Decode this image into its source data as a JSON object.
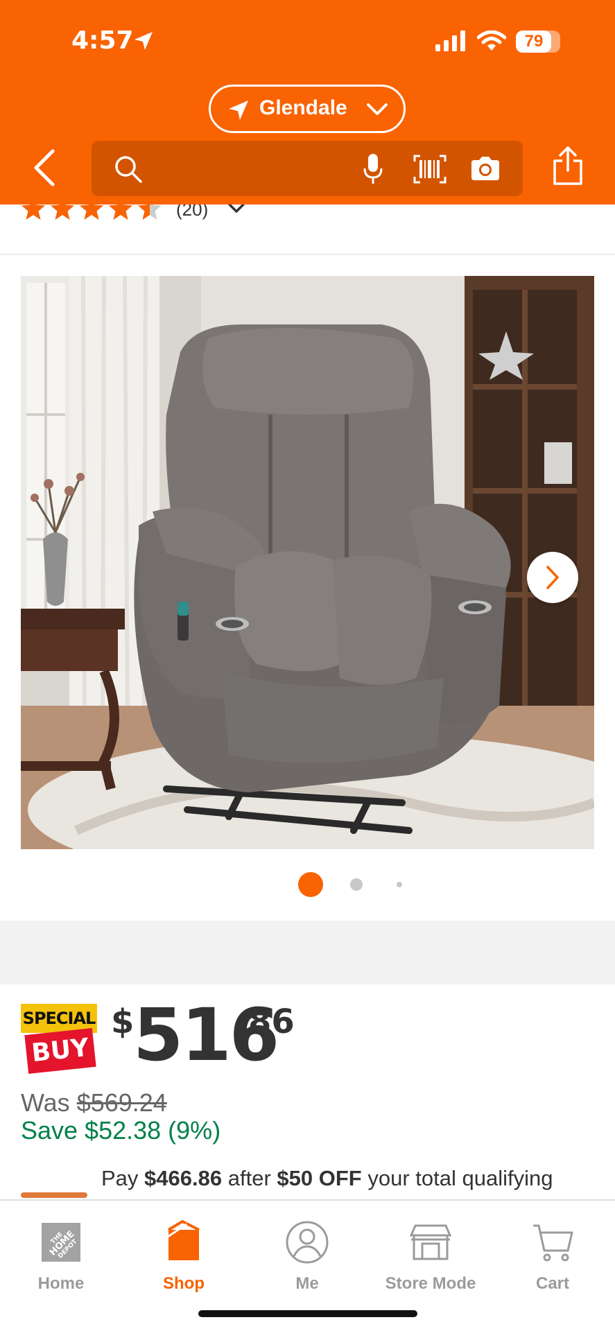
{
  "status_bar": {
    "time": "4:57",
    "battery": "79",
    "battery_level": 0.79
  },
  "header": {
    "location": "Glendale",
    "search_placeholder": ""
  },
  "rating": {
    "stars": 4.5,
    "count": "(20)"
  },
  "gallery": {
    "image_count": 3,
    "current_index": 0
  },
  "pricing": {
    "badge_top": "SPECIAL",
    "badge_bottom": "BUY",
    "currency": "$",
    "dollars": "516",
    "cents": "86",
    "was_label": "Was",
    "was_price": "$569.24",
    "save_text": "Save $52.38 (9%)"
  },
  "promo": {
    "prefix": "Pay",
    "amount": "$466.86",
    "middle": "after",
    "discount": "$50 OFF",
    "suffix": "your total qualifying"
  },
  "nav": {
    "home": "Home",
    "shop": "Shop",
    "me": "Me",
    "store_mode": "Store Mode",
    "cart": "Cart"
  },
  "colors": {
    "brand": "#f96302",
    "save_green": "#00804a",
    "badge_yellow": "#f5c20b",
    "badge_red": "#e4142c"
  }
}
